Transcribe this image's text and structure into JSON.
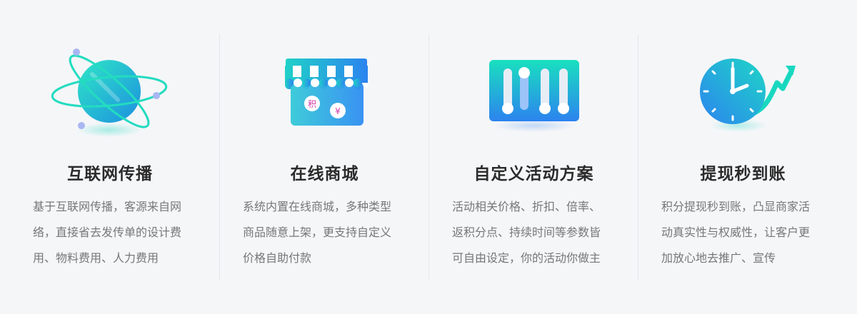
{
  "features": [
    {
      "title": "互联网传播",
      "lines": [
        "基于互联网传播，客源来自网",
        "络，直接省去发传单的设计费",
        "用、物料费用、人力费用"
      ],
      "icon": "globe-orbit-icon"
    },
    {
      "title": "在线商城",
      "lines": [
        "系统内置在线商城，多种类型",
        "商品随意上架，更支持自定义",
        "价格自助付款"
      ],
      "icon": "store-icon",
      "coin_labels": [
        "积",
        "¥"
      ]
    },
    {
      "title": "自定义活动方案",
      "lines": [
        "活动相关价格、折扣、倍率、",
        "返积分点、持续时间等参数皆",
        "可自由设定，你的活动你做主"
      ],
      "icon": "sliders-icon"
    },
    {
      "title": "提现秒到账",
      "lines": [
        "积分提现秒到账，凸显商家活",
        "动真实性与权威性，让客户更",
        "加放心地去推广、宣传"
      ],
      "icon": "clock-arrow-icon"
    }
  ],
  "colors": {
    "teal": "#19d8c0",
    "blue": "#2f8bf0",
    "title": "#2b2b2b",
    "text": "#777777"
  }
}
